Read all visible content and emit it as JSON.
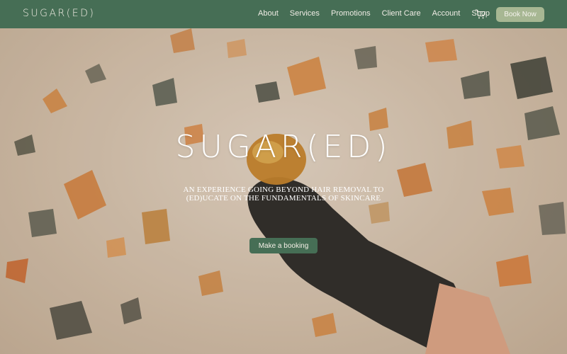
{
  "header": {
    "logo": "SUGAR(ED)",
    "nav": [
      "About",
      "Services",
      "Promotions",
      "Client Care",
      "Account",
      "Shop"
    ],
    "cart_icon": "cart-icon",
    "book_now": "Book Now"
  },
  "hero": {
    "title": "SUGAR(ED)",
    "tagline_line1": "AN EXPERIENCE GOING BEYOND HAIR REMOVAL TO",
    "tagline_line2": "(ED)UCATE ON THE FUNDAMENTALS OF SKINCARE",
    "cta": "Make a booking"
  },
  "colors": {
    "brand_green": "#466e55",
    "book_now_bg": "#a7b793"
  }
}
